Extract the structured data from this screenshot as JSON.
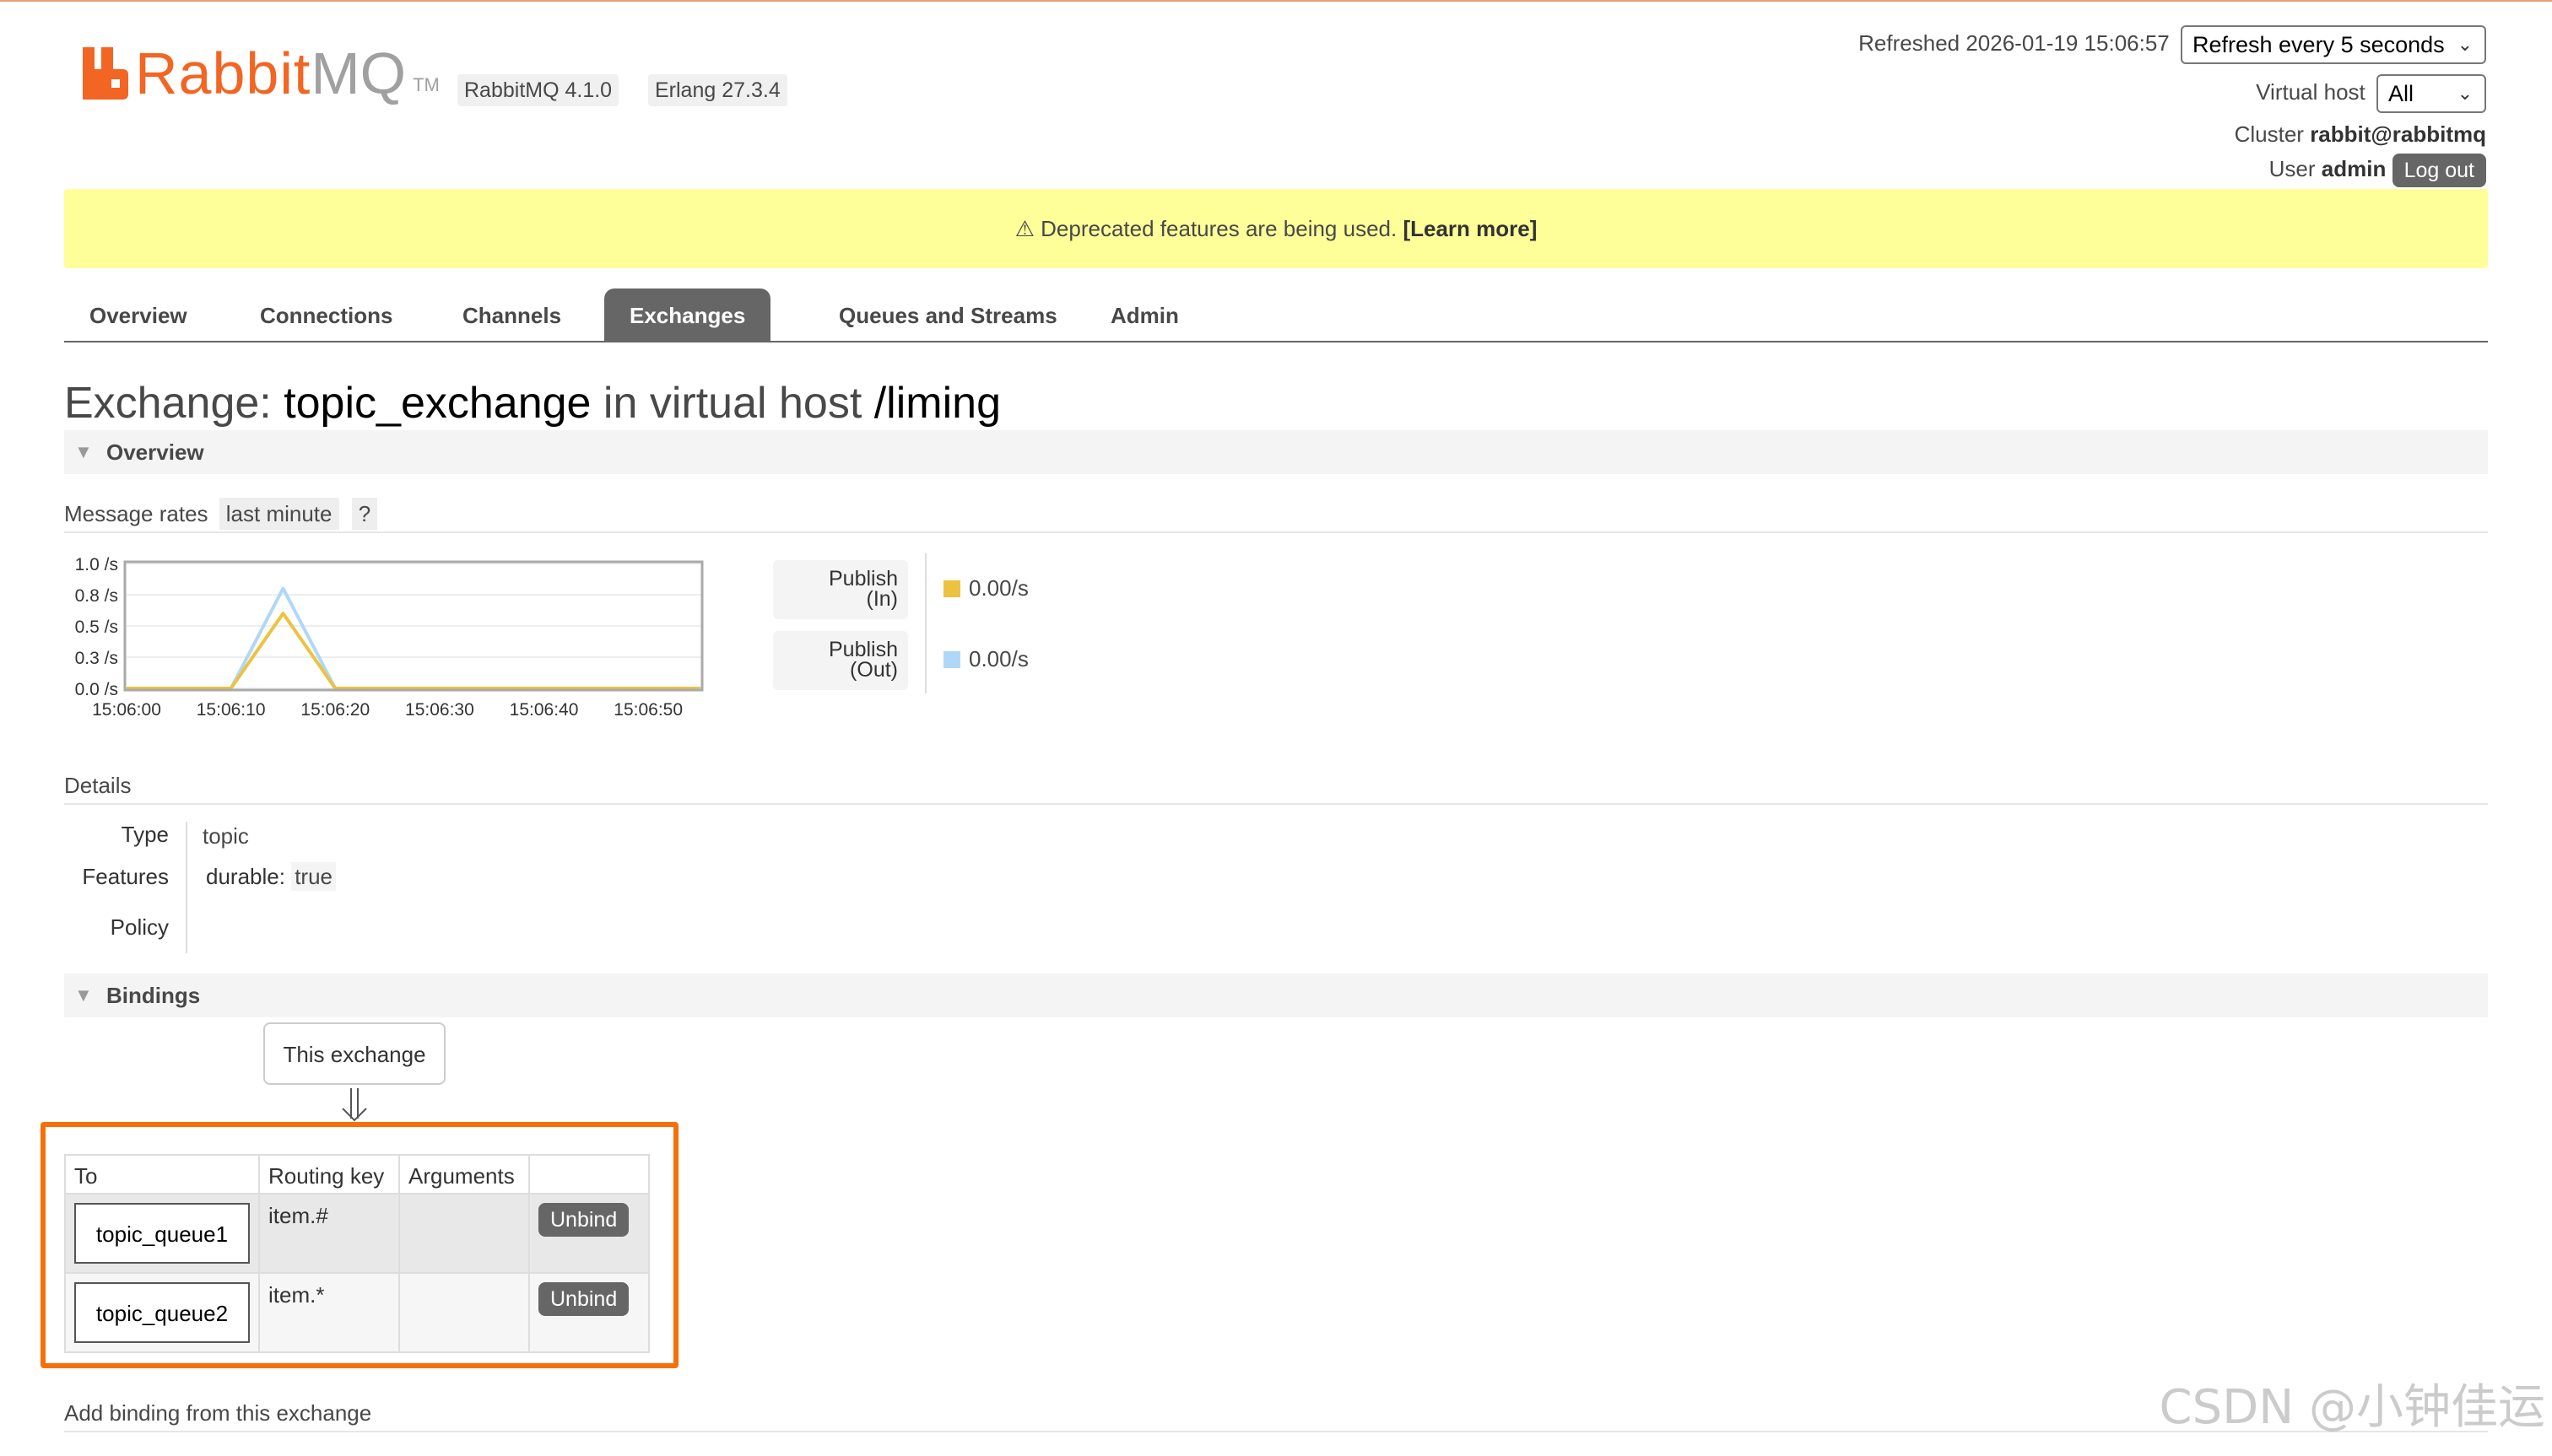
{
  "header": {
    "logo_text_1": "Rabbit",
    "logo_text_2": "MQ",
    "logo_tm": "TM",
    "rabbitmq_version": "RabbitMQ 4.1.0",
    "erlang_version": "Erlang 27.3.4",
    "refreshed_label": "Refreshed 2026-01-19 15:06:57",
    "refresh_select": "Refresh every 5 seconds",
    "virtual_host_label": "Virtual host",
    "virtual_host_value": "All",
    "cluster_label": "Cluster",
    "cluster_value": "rabbit@rabbitmq",
    "user_label": "User",
    "user_value": "admin",
    "logout_label": "Log out"
  },
  "banner": {
    "icon": "warning-icon",
    "text": "⚠ Deprecated features are being used. ",
    "link": "[Learn more]"
  },
  "tabs": [
    {
      "label": "Overview",
      "active": false
    },
    {
      "label": "Connections",
      "active": false
    },
    {
      "label": "Channels",
      "active": false
    },
    {
      "label": "Exchanges",
      "active": true
    },
    {
      "label": "Queues and Streams",
      "active": false
    },
    {
      "label": "Admin",
      "active": false
    }
  ],
  "title": {
    "prefix": "Exchange: ",
    "exchange": "topic_exchange",
    "middle": " in virtual host ",
    "vhost": "/liming"
  },
  "overview": {
    "heading": "Overview",
    "message_rates_label": "Message rates",
    "period": "last minute",
    "help": "?",
    "legend": [
      {
        "label_1": "Publish",
        "label_2": "(In)",
        "value": "0.00/s",
        "color": "#edc240"
      },
      {
        "label_1": "Publish",
        "label_2": "(Out)",
        "value": "0.00/s",
        "color": "#afd8f8"
      }
    ]
  },
  "chart_data": {
    "type": "line",
    "x": [
      "15:06:00",
      "15:06:05",
      "15:06:10",
      "15:06:15",
      "15:06:20",
      "15:06:25",
      "15:06:30",
      "15:06:35",
      "15:06:40",
      "15:06:45",
      "15:06:50",
      "15:06:55"
    ],
    "x_ticks": [
      "15:06:00",
      "15:06:10",
      "15:06:20",
      "15:06:30",
      "15:06:40",
      "15:06:50"
    ],
    "y_ticks": [
      "1.0 /s",
      "0.8 /s",
      "0.5 /s",
      "0.3 /s",
      "0.0 /s"
    ],
    "ylim": [
      0,
      1.0
    ],
    "series": [
      {
        "name": "Publish (In)",
        "color": "#edc240",
        "values": [
          0,
          0,
          0,
          0.6,
          0,
          0,
          0,
          0,
          0,
          0,
          0,
          0
        ]
      },
      {
        "name": "Publish (Out)",
        "color": "#afd8f8",
        "values": [
          0,
          0,
          0,
          0.8,
          0,
          0,
          0,
          0,
          0,
          0,
          0,
          0
        ]
      }
    ],
    "xlabel": "",
    "ylabel": "",
    "grid": true
  },
  "details": {
    "heading": "Details",
    "type_label": "Type",
    "type_value": "topic",
    "features_label": "Features",
    "features_key": "durable:",
    "features_value": "true",
    "policy_label": "Policy"
  },
  "bindings": {
    "heading": "Bindings",
    "this_exchange": "This exchange",
    "columns": [
      "To",
      "Routing key",
      "Arguments",
      ""
    ],
    "rows": [
      {
        "to": "topic_queue1",
        "routing_key": "item.#",
        "arguments": "",
        "action": "Unbind"
      },
      {
        "to": "topic_queue2",
        "routing_key": "item.*",
        "arguments": "",
        "action": "Unbind"
      }
    ],
    "add_binding_label": "Add binding from this exchange"
  },
  "watermark": "CSDN @小钟佳运"
}
